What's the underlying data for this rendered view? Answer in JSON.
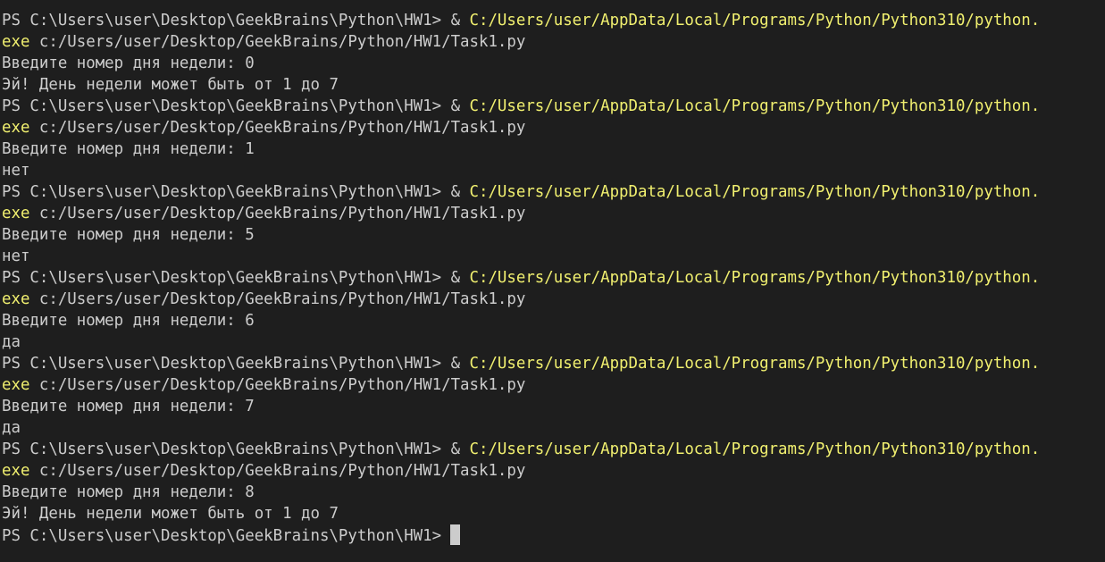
{
  "terminal": {
    "runs": [
      {
        "prompt": "PS C:\\Users\\user\\Desktop\\GeekBrains\\Python\\HW1> ",
        "amp": "& ",
        "exe_path": "C:/Users/user/AppData/Local/Programs/Python/Python310/python.",
        "exe_tail": "exe",
        "script": " c:/Users/user/Desktop/GeekBrains/Python/HW1/Task1.py",
        "input_prompt": "Введите номер дня недели: 0",
        "output": "Эй! День недели может быть от 1 до 7"
      },
      {
        "prompt": "PS C:\\Users\\user\\Desktop\\GeekBrains\\Python\\HW1> ",
        "amp": "& ",
        "exe_path": "C:/Users/user/AppData/Local/Programs/Python/Python310/python.",
        "exe_tail": "exe",
        "script": " c:/Users/user/Desktop/GeekBrains/Python/HW1/Task1.py",
        "input_prompt": "Введите номер дня недели: 1",
        "output": "нет"
      },
      {
        "prompt": "PS C:\\Users\\user\\Desktop\\GeekBrains\\Python\\HW1> ",
        "amp": "& ",
        "exe_path": "C:/Users/user/AppData/Local/Programs/Python/Python310/python.",
        "exe_tail": "exe",
        "script": " c:/Users/user/Desktop/GeekBrains/Python/HW1/Task1.py",
        "input_prompt": "Введите номер дня недели: 5",
        "output": "нет"
      },
      {
        "prompt": "PS C:\\Users\\user\\Desktop\\GeekBrains\\Python\\HW1> ",
        "amp": "& ",
        "exe_path": "C:/Users/user/AppData/Local/Programs/Python/Python310/python.",
        "exe_tail": "exe",
        "script": " c:/Users/user/Desktop/GeekBrains/Python/HW1/Task1.py",
        "input_prompt": "Введите номер дня недели: 6",
        "output": "да"
      },
      {
        "prompt": "PS C:\\Users\\user\\Desktop\\GeekBrains\\Python\\HW1> ",
        "amp": "& ",
        "exe_path": "C:/Users/user/AppData/Local/Programs/Python/Python310/python.",
        "exe_tail": "exe",
        "script": " c:/Users/user/Desktop/GeekBrains/Python/HW1/Task1.py",
        "input_prompt": "Введите номер дня недели: 7",
        "output": "да"
      },
      {
        "prompt": "PS C:\\Users\\user\\Desktop\\GeekBrains\\Python\\HW1> ",
        "amp": "& ",
        "exe_path": "C:/Users/user/AppData/Local/Programs/Python/Python310/python.",
        "exe_tail": "exe",
        "script": " c:/Users/user/Desktop/GeekBrains/Python/HW1/Task1.py",
        "input_prompt": "Введите номер дня недели: 8",
        "output": "Эй! День недели может быть от 1 до 7"
      }
    ],
    "final_prompt": "PS C:\\Users\\user\\Desktop\\GeekBrains\\Python\\HW1>"
  },
  "colors": {
    "background": "#1e1e1e",
    "text": "#cccccc",
    "highlight": "#f0ef6f"
  }
}
